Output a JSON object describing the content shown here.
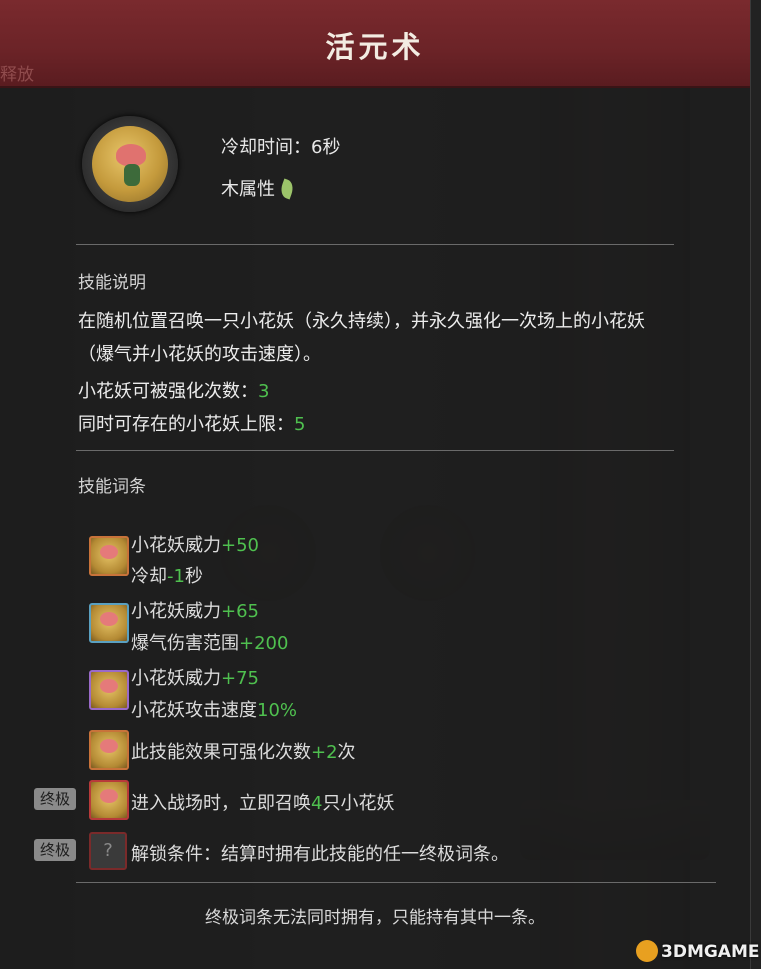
{
  "header": {
    "title": "活元术",
    "ghost_text": "释放"
  },
  "skill": {
    "cooldown": "冷却时间：6秒",
    "element": "木属性",
    "icon": "flower-sprite-icon",
    "element_icon": "leaf-icon"
  },
  "description": {
    "title": "技能说明",
    "text": "在随机位置召唤一只小花妖（永久持续），并永久强化一次场上的小花妖（爆气并小花妖的攻击速度）。",
    "upgrade_label": "小花妖可被强化次数：",
    "upgrade_value": "3",
    "limit_label": "同时可存在的小花妖上限：",
    "limit_value": "5"
  },
  "entries": {
    "title": "技能词条",
    "e0": {
      "a_label": "小花妖威力",
      "a_value": "+50",
      "b_label": "冷却",
      "b_value": "-1",
      "b_suffix": "秒"
    },
    "e1": {
      "a_label": "小花妖威力",
      "a_value": "+65",
      "b_label": "爆气伤害范围",
      "b_value": "+200"
    },
    "e2": {
      "a_label": "小花妖威力",
      "a_value": "+75",
      "b_label": "小花妖攻击速度",
      "b_value": "10%"
    },
    "e3": {
      "a_label": "此技能效果可强化次数",
      "a_value": "+2",
      "a_suffix": "次"
    },
    "e4": {
      "badge": "终极",
      "a_label": "进入战场时，立即召唤",
      "a_value": "4",
      "a_suffix": "只小花妖"
    },
    "e5": {
      "badge": "终极",
      "lock": "?",
      "a_label": "解锁条件：结算时拥有此技能的任一终极词条。"
    }
  },
  "footer": {
    "note": "终极词条无法同时拥有，只能持有其中一条。"
  },
  "watermark": {
    "text": "3DMGAME"
  },
  "colors": {
    "header": "#6b2327",
    "value_green": "#4fc04f",
    "panel": "#1e1e1e"
  }
}
